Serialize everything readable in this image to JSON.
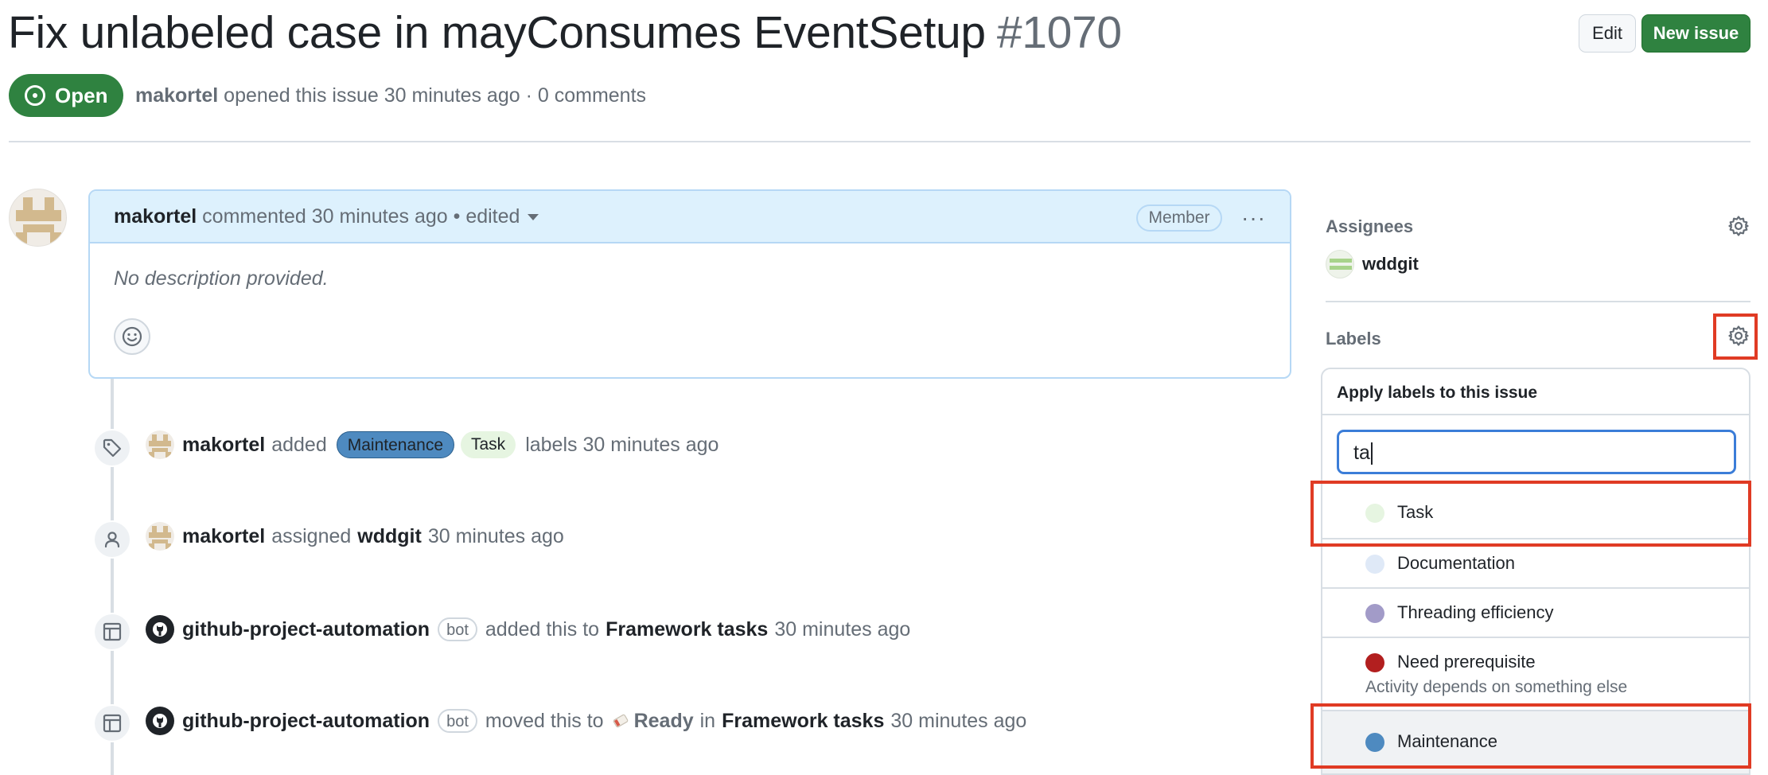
{
  "issue": {
    "title": "Fix unlabeled case in mayConsumes EventSetup",
    "number": "#1070",
    "state": "Open",
    "author": "makortel",
    "meta_rest": "opened this issue 30 minutes ago · 0 comments"
  },
  "header_actions": {
    "edit_label": "Edit",
    "new_issue_label": "New issue"
  },
  "comment": {
    "author": "makortel",
    "meta": "commented 30 minutes ago • edited",
    "role_badge": "Member",
    "more_glyph": "···",
    "body": "No description provided."
  },
  "timeline": [
    {
      "actor": "makortel",
      "verb": "added",
      "labels": [
        "Maintenance",
        "Task"
      ],
      "rest": "labels 30 minutes ago",
      "icon": "tag-icon"
    },
    {
      "actor": "makortel",
      "verb": "assigned",
      "target": "wddgit",
      "rest": "30 minutes ago",
      "icon": "person-icon"
    },
    {
      "actor": "github-project-automation",
      "badge": "bot",
      "verb": "added this to",
      "target": "Framework tasks",
      "rest": "30 minutes ago",
      "icon": "project-icon"
    },
    {
      "actor": "github-project-automation",
      "badge": "bot",
      "verb": "moved this to",
      "status": "Ready",
      "mid": "in",
      "target": "Framework tasks",
      "rest": "30 minutes ago",
      "icon": "project-icon"
    }
  ],
  "sidebar": {
    "assignees_heading": "Assignees",
    "assignee": "wddgit",
    "labels_heading": "Labels"
  },
  "label_menu": {
    "heading": "Apply labels to this issue",
    "search_value": "ta",
    "items": [
      {
        "name": "Task",
        "color": "#e6f5e1"
      },
      {
        "name": "Documentation",
        "color": "#dfe9f7"
      },
      {
        "name": "Threading efficiency",
        "color": "#a29bc8"
      },
      {
        "name": "Need prerequisite",
        "color": "#b21f1f",
        "description": "Activity depends on something else"
      },
      {
        "name": "Maintenance",
        "color": "#4e8ac0"
      }
    ]
  },
  "colors": {
    "open_green": "#2f8240",
    "accent_blue": "#3b7dd8",
    "highlight_red": "#e03b24"
  }
}
